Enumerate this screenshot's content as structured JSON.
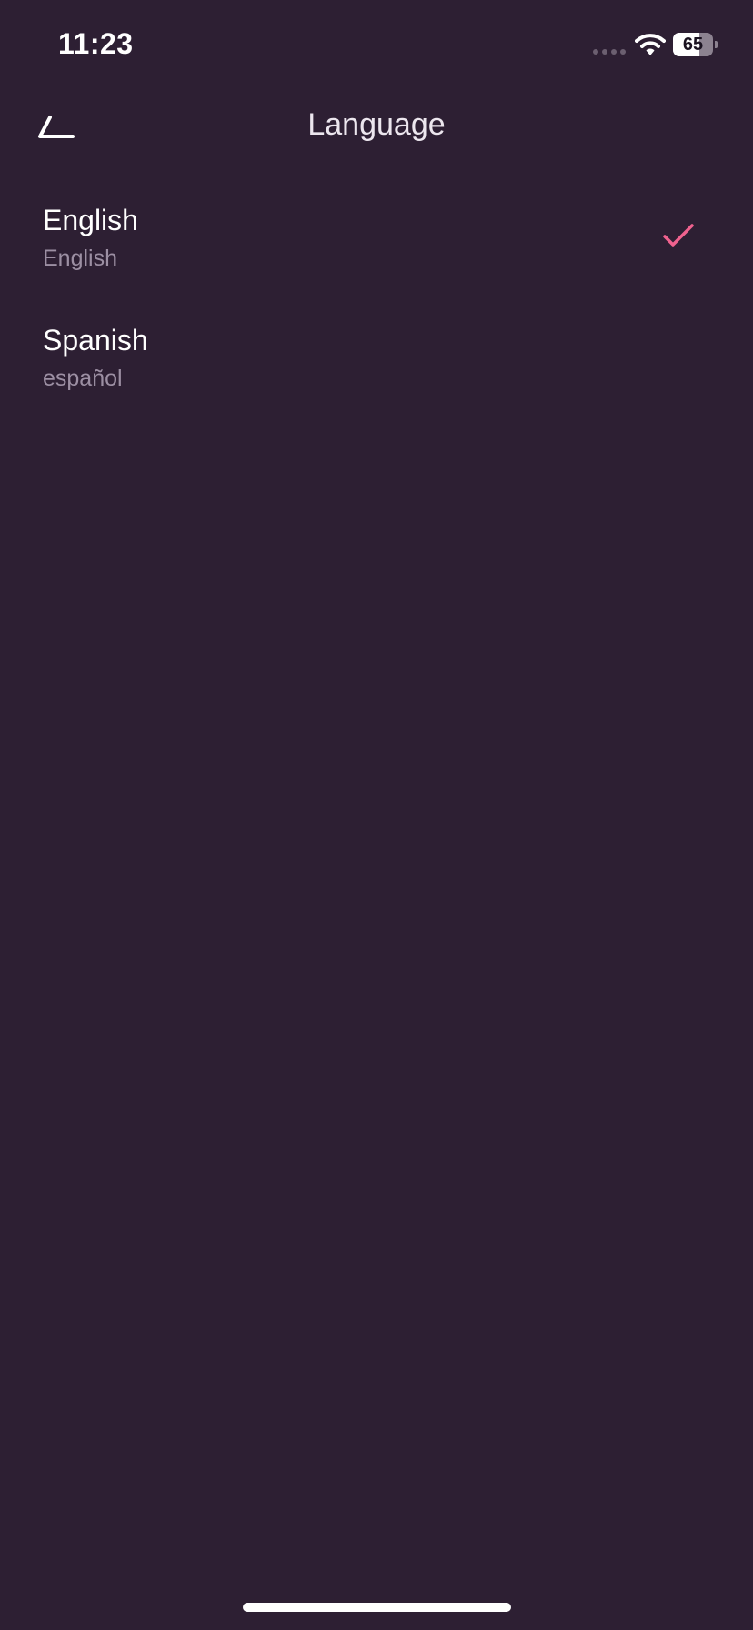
{
  "status_bar": {
    "time": "11:23",
    "battery_level": "65",
    "battery_fraction": 0.65
  },
  "header": {
    "title": "Language",
    "back_icon": "back-arrow-icon"
  },
  "languages": [
    {
      "name": "English",
      "native": "English",
      "selected": true
    },
    {
      "name": "Spanish",
      "native": "español",
      "selected": false
    }
  ],
  "colors": {
    "background": "#2d1f33",
    "accent": "#f0628f",
    "secondary_text": "#9c8fa3"
  }
}
